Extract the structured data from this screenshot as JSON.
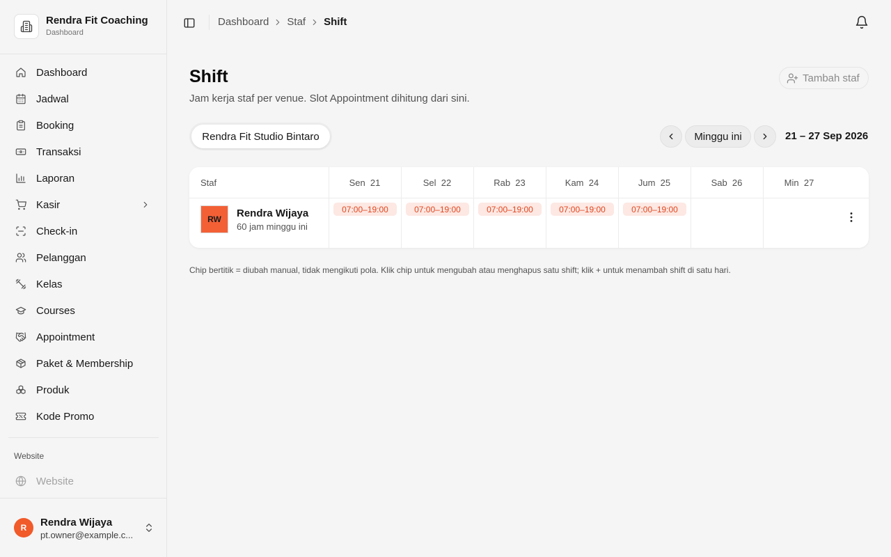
{
  "brand": {
    "name": "Rendra Fit Coaching",
    "subtitle": "Dashboard"
  },
  "sidebar": {
    "items": [
      {
        "label": "Dashboard",
        "icon": "home-icon"
      },
      {
        "label": "Jadwal",
        "icon": "calendar-icon"
      },
      {
        "label": "Booking",
        "icon": "clipboard-icon"
      },
      {
        "label": "Transaksi",
        "icon": "banknote-icon"
      },
      {
        "label": "Laporan",
        "icon": "bar-chart-icon"
      },
      {
        "label": "Kasir",
        "icon": "cart-icon",
        "has_submenu": true
      },
      {
        "label": "Check-in",
        "icon": "scan-icon"
      },
      {
        "label": "Pelanggan",
        "icon": "users-icon"
      },
      {
        "label": "Kelas",
        "icon": "dumbbell-icon"
      },
      {
        "label": "Courses",
        "icon": "graduation-cap-icon"
      },
      {
        "label": "Appointment",
        "icon": "handshake-icon"
      },
      {
        "label": "Paket & Membership",
        "icon": "package-icon"
      },
      {
        "label": "Produk",
        "icon": "boxes-icon"
      },
      {
        "label": "Kode Promo",
        "icon": "ticket-icon"
      }
    ],
    "section_label": "Website",
    "website_item": {
      "label": "Website",
      "icon": "globe-icon"
    }
  },
  "user": {
    "initial": "R",
    "name": "Rendra Wijaya",
    "email": "pt.owner@example.c..."
  },
  "breadcrumb": [
    "Dashboard",
    "Staf",
    "Shift"
  ],
  "page": {
    "title": "Shift",
    "description": "Jam kerja staf per venue. Slot Appointment dihitung dari sini.",
    "add_staff_label": "Tambah staf"
  },
  "venue": {
    "selected": "Rendra Fit Studio Bintaro"
  },
  "week_nav": {
    "current_label": "Minggu ini",
    "range": "21 – 27 Sep 2026"
  },
  "schedule": {
    "staff_header": "Staf",
    "days": [
      "Sen  21",
      "Sel  22",
      "Rab  23",
      "Kam  24",
      "Jum  25",
      "Sab  26",
      "Min  27"
    ],
    "rows": [
      {
        "initials": "RW",
        "name": "Rendra Wijaya",
        "hours": "60 jam minggu ini",
        "shifts": [
          "07:00–19:00",
          "07:00–19:00",
          "07:00–19:00",
          "07:00–19:00",
          "07:00–19:00",
          "",
          ""
        ]
      }
    ]
  },
  "footnote": "Chip bertitik = diubah manual, tidak mengikuti pola. Klik chip untuk mengubah atau menghapus satu shift; klik + untuk menambah shift di satu hari.",
  "colors": {
    "accent": "#f15a29",
    "chip_bg": "#fde8e3",
    "chip_text": "#e0461f"
  }
}
